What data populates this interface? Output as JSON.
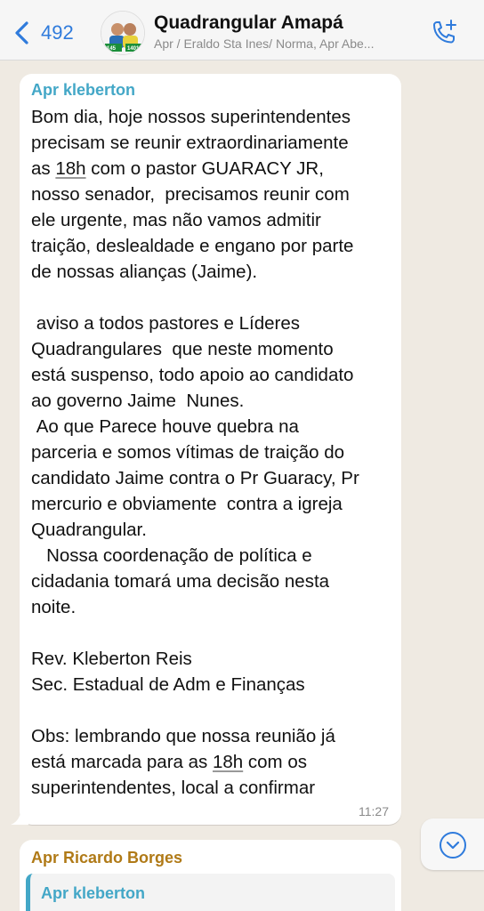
{
  "header": {
    "back_count": "492",
    "title": "Quadrangular Amapá",
    "subtitle": "Apr / Eraldo Sta Ines/ Norma, Apr Abe...",
    "avatar_labels": [
      "145",
      "1401"
    ]
  },
  "messages": [
    {
      "sender": "Apr kleberton",
      "text_before_1": "Bom dia, hoje nossos superintendentes\nprecisam se reunir extraordinariamente\nas ",
      "link_1": "18h",
      "text_after_1": " com o pastor GUARACY JR,\nnosso senador,  precisamos reunir com\nele urgente, mas não vamos admitir\ntraição, deslealdade e engano por parte\nde nossas alianças (Jaime).\n\n aviso a todos pastores e Líderes\nQuadrangulares  que neste momento\nestá suspenso, todo apoio ao candidato\nao governo Jaime  Nunes.\n Ao que Parece houve quebra na\nparceria e somos vítimas de traição do\ncandidato Jaime contra o Pr Guaracy, Pr\nmercurio e obviamente  contra a igreja\nQuadrangular.\n   Nossa coordenação de política e\ncidadania tomará uma decisão nesta\nnoite.\n\nRev. Kleberton Reis\nSec. Estadual de Adm e Finanças\n\nObs: lembrando que nossa reunião já\nestá marcada para as ",
      "link_2": "18h",
      "text_after_2": " com os\nsuperintendentes, local a confirmar",
      "time": "11:27"
    },
    {
      "sender": "Apr Ricardo Borges",
      "quoted_sender": "Apr kleberton"
    }
  ],
  "colors": {
    "accent": "#2f7bdc",
    "sender1": "#43a7c7",
    "sender2": "#b07a17",
    "background": "#efeae2"
  }
}
